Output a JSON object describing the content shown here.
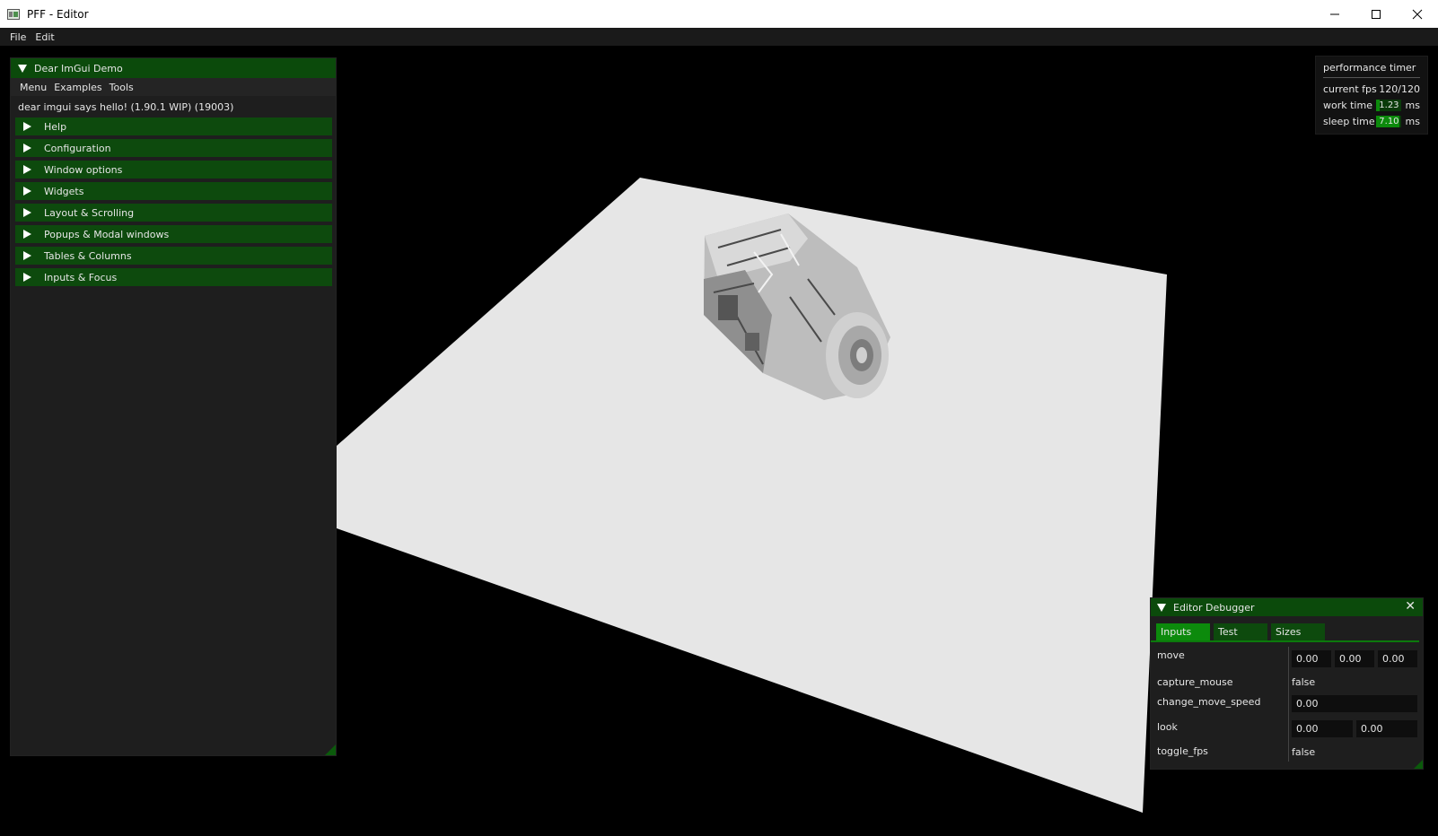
{
  "window": {
    "title": "PFF - Editor"
  },
  "menubar": {
    "items": [
      "File",
      "Edit"
    ]
  },
  "demo": {
    "title": "Dear ImGui Demo",
    "menu": [
      "Menu",
      "Examples",
      "Tools"
    ],
    "hello": "dear imgui says hello! (1.90.1 WIP) (19003)",
    "sections": [
      "Help",
      "Configuration",
      "Window options",
      "Widgets",
      "Layout & Scrolling",
      "Popups & Modal windows",
      "Tables & Columns",
      "Inputs & Focus"
    ]
  },
  "perf": {
    "title": "performance timer",
    "fps_label": "current fps",
    "fps_value": "120/120",
    "work_label": "work time",
    "work_value": "1.23",
    "work_fill": 0.17,
    "sleep_label": "sleep time",
    "sleep_value": "7.10",
    "sleep_fill": 0.95,
    "unit": "ms"
  },
  "debugger": {
    "title": "Editor Debugger",
    "tabs": [
      "Inputs",
      "Test",
      "Sizes"
    ],
    "active_tab": "Inputs",
    "props": {
      "move": {
        "label": "move",
        "values": [
          "0.00",
          "0.00",
          "0.00"
        ]
      },
      "capture_mouse": {
        "label": "capture_mouse",
        "value": "false"
      },
      "change_move_speed": {
        "label": "change_move_speed",
        "value": "0.00"
      },
      "look": {
        "label": "look",
        "values": [
          "0.00",
          "0.00"
        ]
      },
      "toggle_fps": {
        "label": "toggle_fps",
        "value": "false"
      }
    }
  },
  "colors": {
    "accent": "#0c8a0c",
    "header": "#0b4a0b",
    "panel": "#1e1e1e",
    "plane": "#e6e6e6"
  },
  "icons": [
    "app-icon",
    "minimize-icon",
    "maximize-icon",
    "close-icon",
    "collapse-arrow-icon",
    "expand-arrow-icon"
  ]
}
